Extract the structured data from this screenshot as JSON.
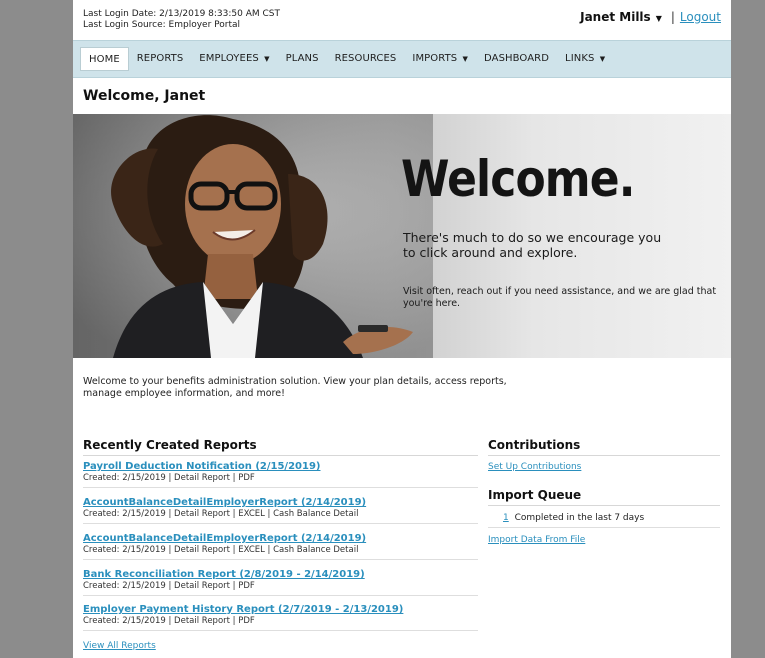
{
  "header": {
    "login_date": "Last Login Date: 2/13/2019 8:33:50 AM CST",
    "login_source": "Last Login Source: Employer Portal",
    "user_name": "Janet Mills",
    "separator": "|",
    "logout_label": "Logout"
  },
  "nav": {
    "items": [
      {
        "label": "HOME",
        "active": true
      },
      {
        "label": "REPORTS"
      },
      {
        "label": "EMPLOYEES",
        "dropdown": true
      },
      {
        "label": "PLANS"
      },
      {
        "label": "RESOURCES"
      },
      {
        "label": "IMPORTS",
        "dropdown": true
      },
      {
        "label": "DASHBOARD"
      },
      {
        "label": "LINKS",
        "dropdown": true
      }
    ],
    "caret": "▼"
  },
  "welcome": {
    "title": "Welcome, Janet",
    "banner_headline": "Welcome.",
    "banner_sub": "There's much to do so we encourage you to click around and explore.",
    "banner_note": "Visit often, reach out if you need assistance, and we are glad that you're here.",
    "intro": "Welcome to your benefits administration solution. View your plan details, access reports, manage employee information, and more!"
  },
  "reports": {
    "title": "Recently Created Reports",
    "items": [
      {
        "name": "Payroll Deduction Notification (2/15/2019)",
        "meta": "Created: 2/15/2019 | Detail Report | PDF"
      },
      {
        "name": "AccountBalanceDetailEmployerReport (2/14/2019)",
        "meta": "Created: 2/15/2019 | Detail Report | EXCEL | Cash Balance Detail"
      },
      {
        "name": "AccountBalanceDetailEmployerReport (2/14/2019)",
        "meta": "Created: 2/15/2019 | Detail Report | EXCEL | Cash Balance Detail"
      },
      {
        "name": "Bank Reconciliation Report (2/8/2019 - 2/14/2019)",
        "meta": "Created: 2/15/2019 | Detail Report | PDF"
      },
      {
        "name": "Employer Payment History Report (2/7/2019 - 2/13/2019)",
        "meta": "Created: 2/15/2019 | Detail Report | PDF"
      }
    ],
    "view_all": "View All Reports"
  },
  "contributions": {
    "title": "Contributions",
    "setup_link": "Set Up Contributions"
  },
  "import_queue": {
    "title": "Import Queue",
    "count": "1",
    "status": "Completed in the last 7 days",
    "import_link": "Import Data From File"
  },
  "colors": {
    "link": "#2a8fbd",
    "nav_bg": "#cfe3ea",
    "frame": "#8c8c8c"
  }
}
